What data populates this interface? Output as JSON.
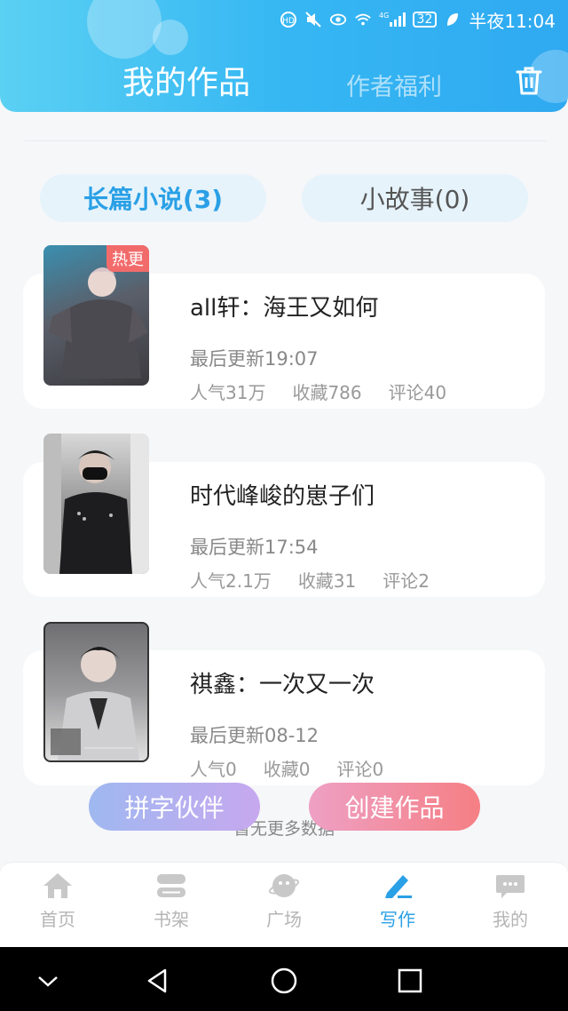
{
  "status_bar": {
    "battery": "32",
    "time": "半夜11:04",
    "network": "4G"
  },
  "header": {
    "tab_main": "我的作品",
    "tab_other": "作者福利"
  },
  "pills": {
    "long": "长篇小说(3)",
    "short": "小故事(0)"
  },
  "books": [
    {
      "title": "all轩：海王又如何",
      "updated": "最后更新19:07",
      "popularity": "人气31万",
      "favorites": "收藏786",
      "comments": "评论40",
      "badge": "热更"
    },
    {
      "title": "时代峰峻的崽子们",
      "updated": "最后更新17:54",
      "popularity": "人气2.1万",
      "favorites": "收藏31",
      "comments": "评论2"
    },
    {
      "title": "祺鑫：一次又一次",
      "updated": "最后更新08-12",
      "popularity": "人气0",
      "favorites": "收藏0",
      "comments": "评论0"
    }
  ],
  "buttons": {
    "partner": "拼字伙伴",
    "create": "创建作品"
  },
  "footer_text": "暂无更多数据",
  "bottom_nav": [
    {
      "label": "首页",
      "icon": "home-icon"
    },
    {
      "label": "书架",
      "icon": "bookshelf-icon"
    },
    {
      "label": "广场",
      "icon": "planet-icon"
    },
    {
      "label": "写作",
      "icon": "pen-icon",
      "active": true
    },
    {
      "label": "我的",
      "icon": "chat-icon"
    }
  ],
  "colors": {
    "header_start": "#5ad0f3",
    "header_end": "#2fa9f1",
    "accent": "#2aa0e6",
    "hot_badge": "#f26b6b"
  }
}
